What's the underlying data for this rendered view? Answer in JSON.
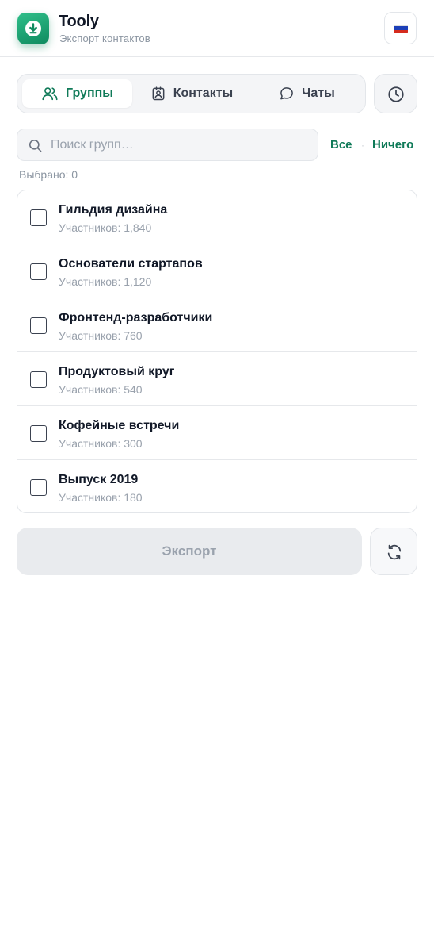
{
  "app": {
    "title": "Tooly",
    "subtitle": "Экспорт контактов",
    "icon": "download-icon",
    "brand_color": "#0f8a5f"
  },
  "language": {
    "flag": "russia-flag-icon"
  },
  "tabs": [
    {
      "label": "Группы",
      "icon": "users-icon",
      "active": true
    },
    {
      "label": "Контакты",
      "icon": "contact-card-icon",
      "active": false
    },
    {
      "label": "Чаты",
      "icon": "chat-bubble-icon",
      "active": false
    }
  ],
  "history": {
    "icon": "clock-icon"
  },
  "search": {
    "placeholder": "Поиск групп…",
    "value": ""
  },
  "selection": {
    "all_label": "Все",
    "none_label": "Ничего",
    "count_text": "Выбрано: 0"
  },
  "groups": [
    {
      "name": "Гильдия дизайна",
      "meta": "Участников: 1,840",
      "checked": false
    },
    {
      "name": "Основатели стартапов",
      "meta": "Участников: 1,120",
      "checked": false
    },
    {
      "name": "Фронтенд-разработчики",
      "meta": "Участников: 760",
      "checked": false
    },
    {
      "name": "Продуктовый круг",
      "meta": "Участников: 540",
      "checked": false
    },
    {
      "name": "Кофейные встречи",
      "meta": "Участников: 300",
      "checked": false
    },
    {
      "name": "Выпуск 2019",
      "meta": "Участников: 180",
      "checked": false
    }
  ],
  "actions": {
    "export_label": "Экспорт",
    "refresh_icon": "refresh-icon"
  }
}
